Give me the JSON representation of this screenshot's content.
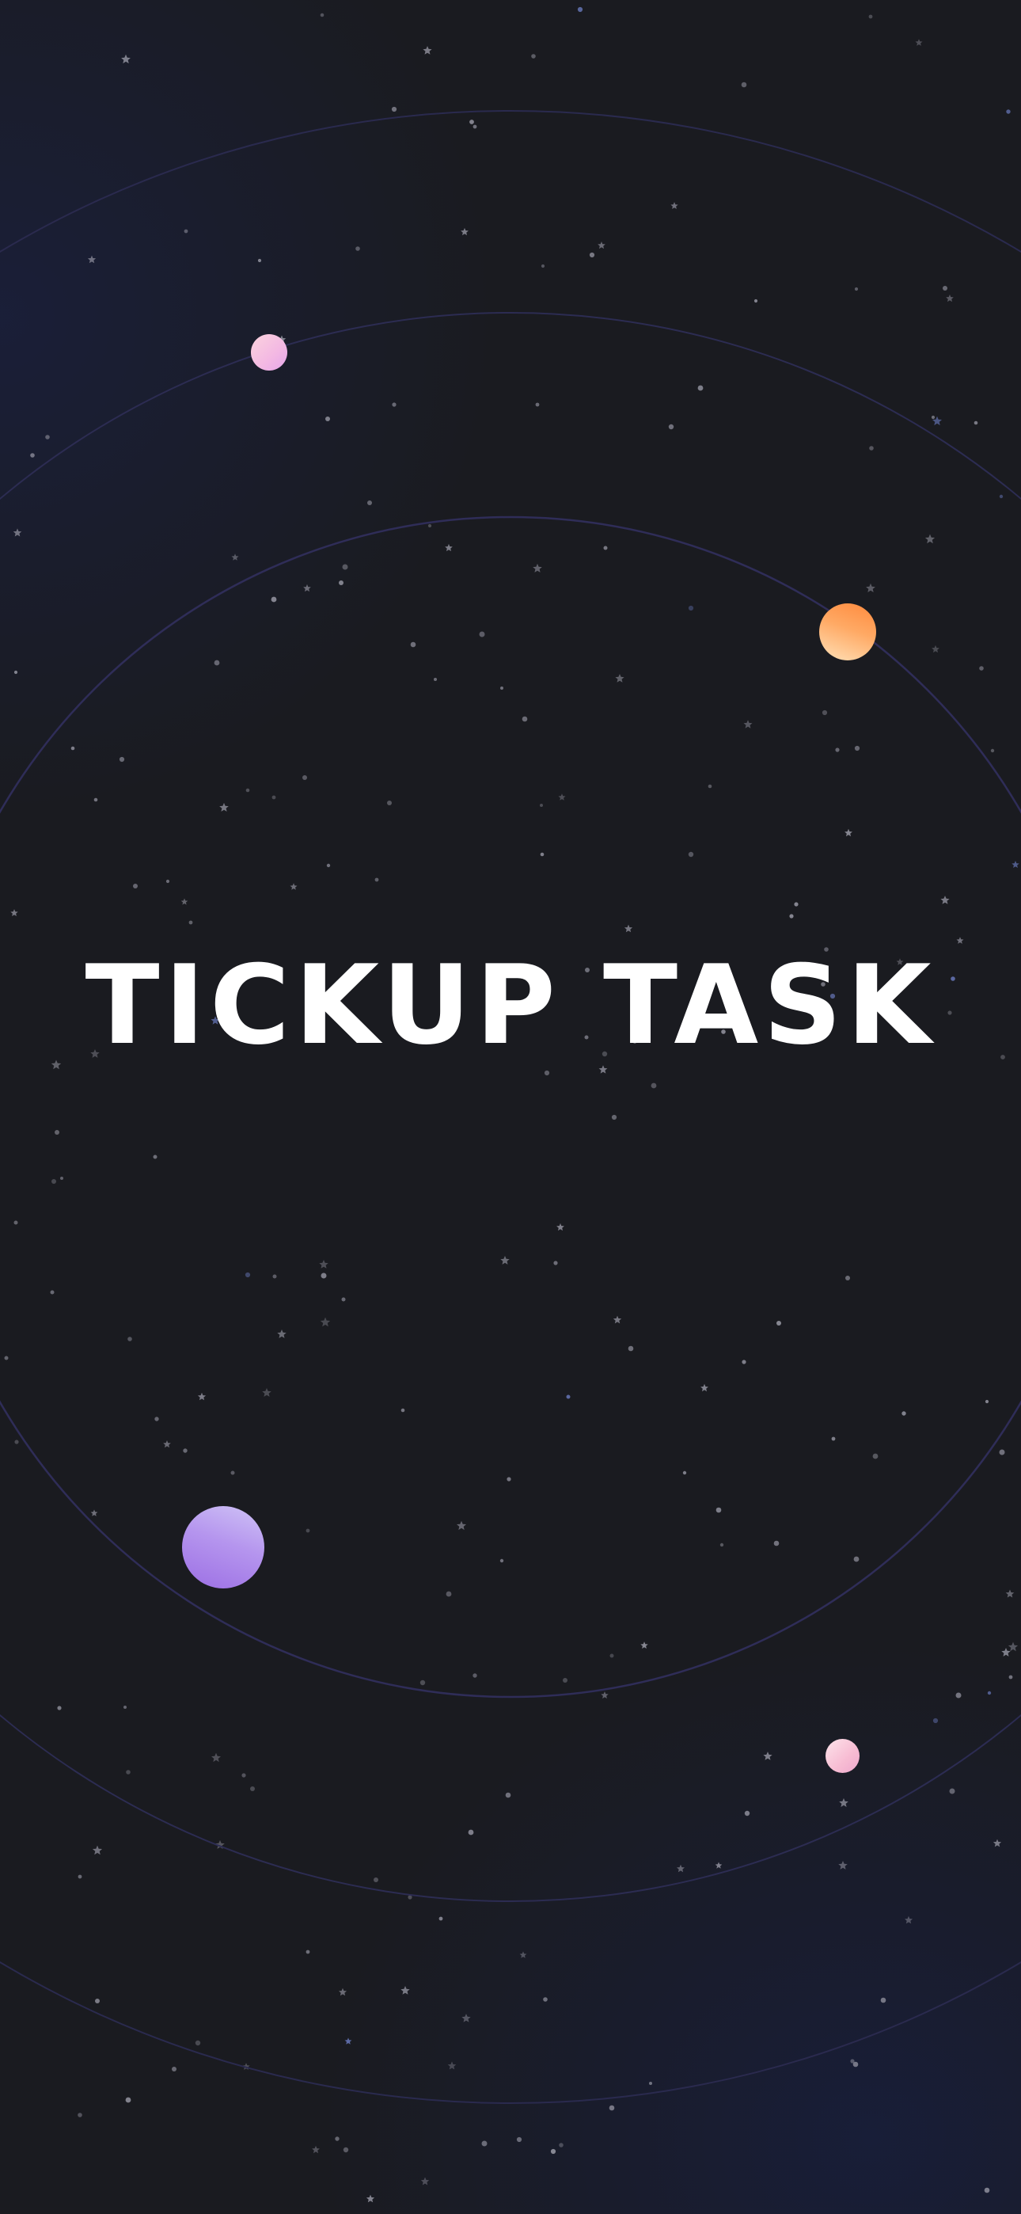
{
  "splash": {
    "app_title": "TICKUP TASK"
  },
  "colors": {
    "background": "#1a1b20",
    "background_glow": "#1a2040",
    "orbit_line": "#2c2c56",
    "title_text": "#ffffff",
    "star": "#9a9aa6",
    "planet_pink": "#f3b8e3",
    "planet_orange": "#ffa964",
    "planet_purple": "#b595ee"
  },
  "decor": {
    "starfield": "star-icons",
    "orbit_rings": 3,
    "planets": [
      "pink-planet",
      "orange-planet",
      "purple-planet",
      "pink-planet"
    ]
  }
}
